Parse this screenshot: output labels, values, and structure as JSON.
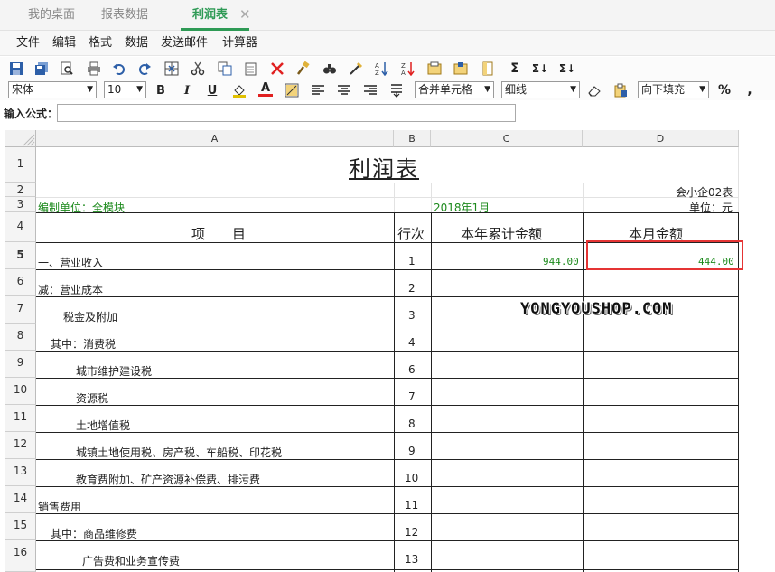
{
  "tabs": [
    {
      "label": "我的桌面",
      "active": false
    },
    {
      "label": "报表数据",
      "active": false
    },
    {
      "label": "利润表",
      "active": true
    }
  ],
  "tab_close_glyph": "✕",
  "menu": [
    "文件",
    "编辑",
    "格式",
    "数据",
    "发送邮件",
    "计算器"
  ],
  "toolbar": {
    "font_family": "宋体",
    "font_size": "10",
    "bold_label": "B",
    "italic_label": "I",
    "underline_label": "U",
    "font_color_label": "A",
    "merge": "合并单元格",
    "border": "细线",
    "fill": "向下填充",
    "percent_label": "%",
    "comma_label": ",",
    "sum1": "Σ",
    "sum2": "Σ↓",
    "sum3": "Σ↓"
  },
  "formula": {
    "label": "输入公式：",
    "value": ""
  },
  "sheet": {
    "columns": [
      "A",
      "B",
      "C",
      "D"
    ],
    "rows": [
      "1",
      "2",
      "3",
      "4",
      "5",
      "6",
      "7",
      "8",
      "9",
      "10",
      "11",
      "12",
      "13",
      "14",
      "15",
      "16"
    ],
    "title": "利润表",
    "code": "会小企02表",
    "unit_label": "编制单位：全模块",
    "period": "2018年1月",
    "currency": "单位：元",
    "headers": {
      "item": "项　　目",
      "line": "行次",
      "ytd": "本年累计金额",
      "month": "本月金额"
    },
    "items": [
      {
        "label": "一、营业收入",
        "line": "1",
        "ytd": "944.00",
        "month": "444.00"
      },
      {
        "label": "减：营业成本",
        "line": "2",
        "ytd": "",
        "month": ""
      },
      {
        "label": "税金及附加",
        "line": "3",
        "ytd": "",
        "month": ""
      },
      {
        "label": "其中：消费税",
        "line": "4",
        "ytd": "",
        "month": ""
      },
      {
        "label": "城市维护建设税",
        "line": "6",
        "ytd": "",
        "month": ""
      },
      {
        "label": "资源税",
        "line": "7",
        "ytd": "",
        "month": ""
      },
      {
        "label": "土地增值税",
        "line": "8",
        "ytd": "",
        "month": ""
      },
      {
        "label": "城镇土地使用税、房产税、车船税、印花税",
        "line": "9",
        "ytd": "",
        "month": ""
      },
      {
        "label": "教育费附加、矿产资源补偿费、排污费",
        "line": "10",
        "ytd": "",
        "month": ""
      },
      {
        "label": "销售费用",
        "line": "11",
        "ytd": "",
        "month": ""
      },
      {
        "label": "其中：商品维修费",
        "line": "12",
        "ytd": "",
        "month": ""
      },
      {
        "label": "广告费和业务宣传费",
        "line": "13",
        "ytd": "",
        "month": ""
      }
    ],
    "selected_row": "5",
    "watermark": "YONGYOUSHOP.COM"
  },
  "colors": {
    "accent": "#2e9a55",
    "green_text": "#1d8a1d",
    "selection": "#e53434"
  }
}
